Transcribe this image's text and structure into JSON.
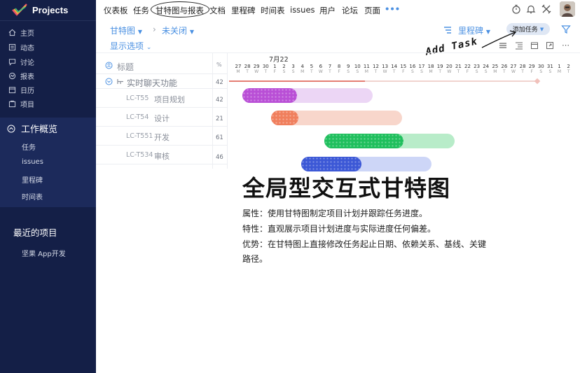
{
  "brand": {
    "name": "Projects"
  },
  "sidebar": {
    "items": [
      {
        "label": "主页",
        "icon": "home-icon"
      },
      {
        "label": "动态",
        "icon": "feed-icon"
      },
      {
        "label": "讨论",
        "icon": "chat-icon"
      },
      {
        "label": "报表",
        "icon": "report-icon"
      },
      {
        "label": "日历",
        "icon": "calendar-icon"
      },
      {
        "label": "项目",
        "icon": "project-icon"
      }
    ],
    "workspace": {
      "title": "工作概览",
      "items": [
        "任务",
        "issues",
        "里程碑",
        "时间表"
      ]
    },
    "recent": {
      "title": "最近的项目",
      "items": [
        "坚果 App开发"
      ]
    }
  },
  "topnav": {
    "items": [
      "仪表板",
      "任务",
      "甘特图与报表",
      "文档",
      "里程碑",
      "时间表",
      "issues",
      "用户",
      "论坛",
      "页面"
    ],
    "more": "•••"
  },
  "subheader": {
    "view": "甘特图",
    "filter": "未关闭",
    "options": "显示选项",
    "milestone": "里程碑",
    "add_task": "添加任务",
    "annotation": "Add Task"
  },
  "gantt": {
    "col_title": "标题",
    "col_pct": "%",
    "month": "7月22",
    "days": [
      "27",
      "28",
      "29",
      "30",
      "1",
      "2",
      "3",
      "4",
      "5",
      "6",
      "7",
      "8",
      "9",
      "10",
      "11",
      "12",
      "13",
      "14",
      "15",
      "16",
      "17",
      "18",
      "19",
      "20",
      "21",
      "22",
      "23",
      "24",
      "25",
      "26",
      "27",
      "28",
      "29",
      "30",
      "31",
      "1",
      "2"
    ],
    "dows": [
      "M",
      "T",
      "W",
      "T",
      "F",
      "S",
      "S",
      "M",
      "T",
      "W",
      "T",
      "F",
      "S",
      "S",
      "M",
      "T",
      "W",
      "T",
      "F",
      "S",
      "S",
      "M",
      "T",
      "W",
      "T",
      "F",
      "S",
      "S",
      "M",
      "T",
      "W",
      "T",
      "F",
      "S",
      "S",
      "M",
      "T"
    ],
    "group": {
      "name": "实时聊天功能",
      "pct": "42"
    },
    "tasks": [
      {
        "code": "LC-T55",
        "name": "项目规划",
        "pct": "42",
        "color": "#b94fd6",
        "light": "#ecd6f5"
      },
      {
        "code": "LC-T54",
        "name": "设计",
        "pct": "21",
        "color": "#f07f5d",
        "light": "#f8d6cb"
      },
      {
        "code": "LC-T551",
        "name": "开发",
        "pct": "61",
        "color": "#1fbf5d",
        "light": "#b8ecc9"
      },
      {
        "code": "LC-T534",
        "name": "审核",
        "pct": "46",
        "color": "#3c58d6",
        "light": "#cdd6f7"
      }
    ]
  },
  "feature": {
    "headline": "全局型交互式甘特图",
    "lines": [
      "属性：使用甘特图制定项目计划并跟踪任务进度。",
      "特性：直观展示项目计划进度与实际进度任何偏差。",
      "优势：在甘特图上直接修改任务起止日期、依赖关系、基线、关键",
      "路径。"
    ]
  },
  "colors": {
    "sidebar_bg": "#141f47",
    "accent": "#4a90e2",
    "workspace_bg": "#1c2a5b"
  }
}
